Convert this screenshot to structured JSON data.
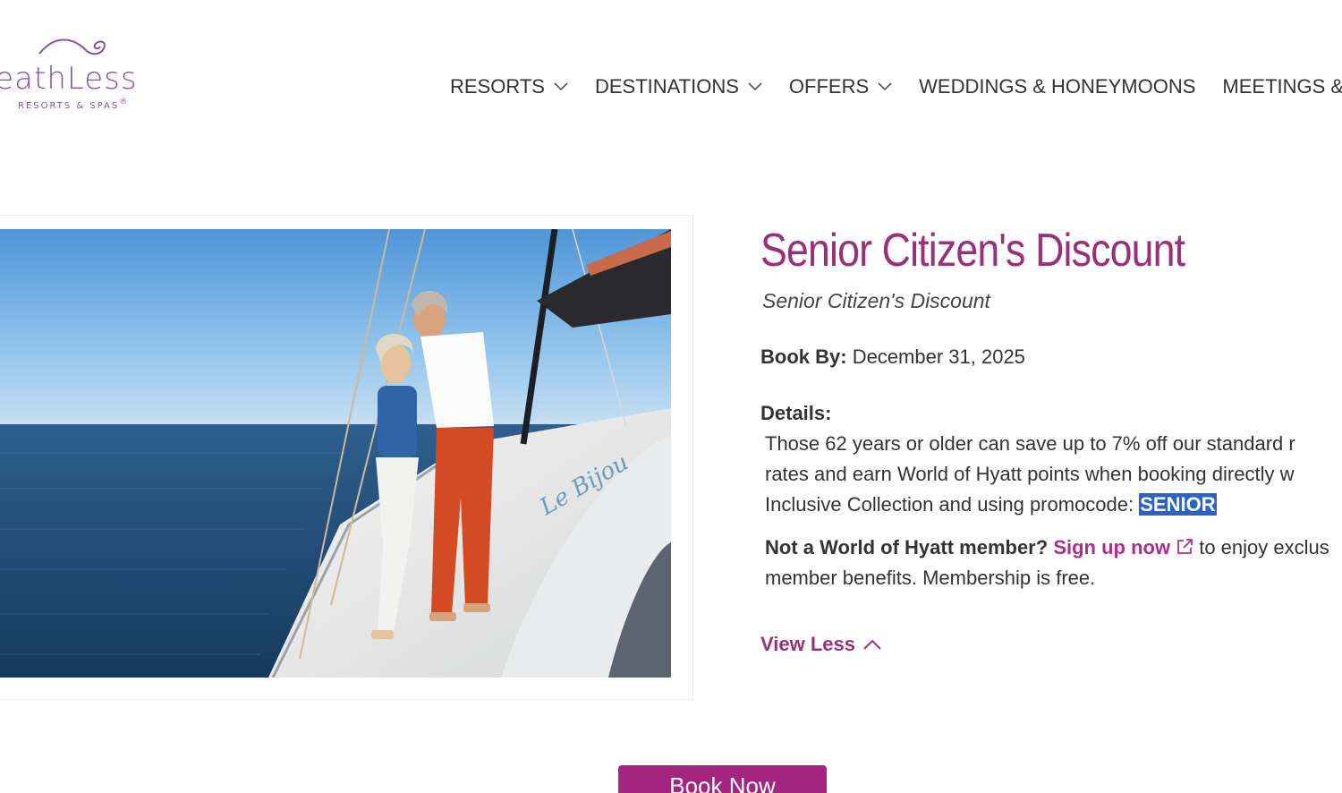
{
  "brand": {
    "logo_word": "reathLess",
    "logo_sub": "RESORTS & SPAS",
    "logo_reg": "®",
    "color": "#8a4fa6"
  },
  "nav": {
    "items": [
      {
        "label": "RESORTS",
        "has_dropdown": true
      },
      {
        "label": "DESTINATIONS",
        "has_dropdown": true
      },
      {
        "label": "OFFERS",
        "has_dropdown": true
      },
      {
        "label": "WEDDINGS & HONEYMOONS",
        "has_dropdown": false
      },
      {
        "label": "MEETINGS &",
        "has_dropdown": false
      }
    ]
  },
  "offer": {
    "title": "Senior Citizen's Discount",
    "subtitle": "Senior Citizen's Discount",
    "book_by_label": "Book By:",
    "book_by_value": "December 31, 2025",
    "details_label": "Details:",
    "details_lines": [
      "Those 62 years or older can save up to 7% off our standard r",
      "rates and earn World of Hyatt points when booking directly w",
      "Inclusive Collection and using promocode: "
    ],
    "promocode": "SENIOR",
    "member_question": "Not a World of Hyatt member?",
    "signup_label": "Sign up now",
    "member_after": "to enjoy exclus",
    "member_line2": "member benefits. Membership is free.",
    "view_less_label": "View Less",
    "book_now_label": "Book Now"
  },
  "colors": {
    "accent": "#9a2f7c",
    "link": "#b02d87",
    "button": "#a4257f",
    "selection": "#2a62c8"
  },
  "icons": {
    "nav_dropdown": "chevron-down-icon",
    "external": "external-link-icon",
    "view_less": "chevron-up-icon"
  }
}
